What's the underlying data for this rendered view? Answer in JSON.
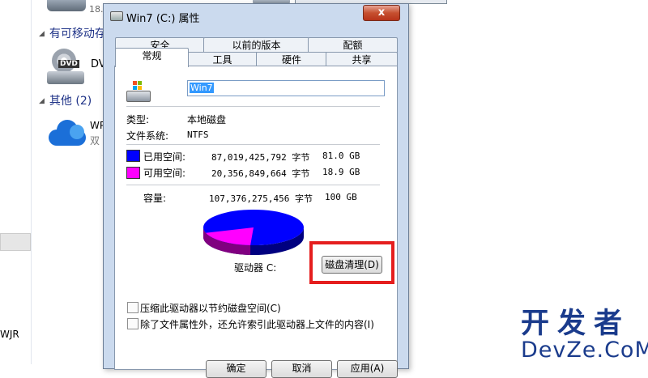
{
  "explorer": {
    "top_drive_text": "18.",
    "removable_header": "有可移动存",
    "dvd_label": "DVD",
    "dvd_text": "DV",
    "other_header": "其他 (2)",
    "cloud_line1": "WP",
    "cloud_line2": "双",
    "wjr_text": "WJR"
  },
  "watermark": {
    "line1": "开发者",
    "line2": "DevZe.CoM"
  },
  "dialog": {
    "title": "Win7 (C:) 属性",
    "close_glyph": "x",
    "tabs_row1": [
      "安全",
      "以前的版本",
      "配额"
    ],
    "tabs_row2": [
      "常规",
      "工具",
      "硬件",
      "共享"
    ],
    "active_tab": "常规",
    "drive_name": "Win7",
    "type_label": "类型:",
    "type_value": "本地磁盘",
    "fs_label": "文件系统:",
    "fs_value": "NTFS",
    "used": {
      "label": "已用空间:",
      "bytes": "87,019,425,792 字节",
      "size": "81.0 GB",
      "color": "#0000ff"
    },
    "free": {
      "label": "可用空间:",
      "bytes": "20,356,849,664 字节",
      "size": "18.9 GB",
      "color": "#ff00ff"
    },
    "capacity": {
      "label": "容量:",
      "bytes": "107,376,275,456 字节",
      "size": "100 GB"
    },
    "used_fraction": 0.81,
    "drive_label": "驱动器 C:",
    "cleanup_button": "磁盘清理(D)",
    "compress_label": "压缩此驱动器以节约磁盘空间(C)",
    "index_label": "除了文件属性外，还允许索引此驱动器上文件的内容(I)",
    "ok_button": "确定",
    "cancel_button": "取消",
    "apply_button": "应用(A)"
  }
}
